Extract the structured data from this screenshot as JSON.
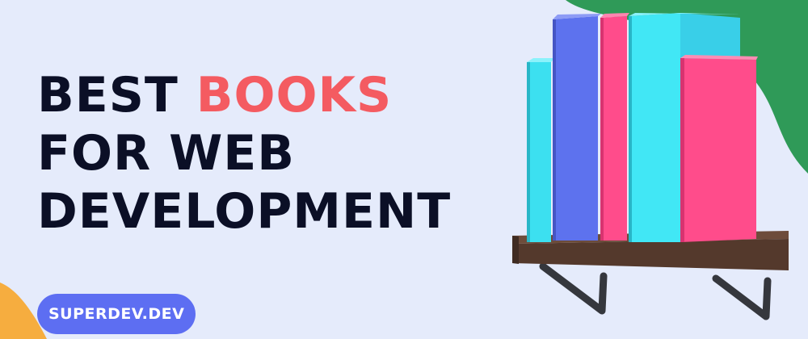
{
  "headline": {
    "line1_word1": "BEST",
    "line1_word2": "BOOKS",
    "line2": "FOR WEB",
    "line3": "DEVELOPMENT"
  },
  "badge": {
    "label": "SUPERDEV.DEV"
  },
  "illustration": {
    "subject": "books-on-wall-shelf"
  },
  "colors": {
    "background": "#e5ebfb",
    "headline_text": "#0b0f26",
    "headline_accent": "#f45b61",
    "badge_background": "#5d6ef2",
    "badge_text": "#ffffff",
    "blob_green": "#2f9a58",
    "blob_orange": "#f6ad3f",
    "book_cyan": "#3ce0f0",
    "book_blue": "#5d72ee",
    "book_pink": "#ff4c8b",
    "shelf_wood": "#5a3f31"
  }
}
